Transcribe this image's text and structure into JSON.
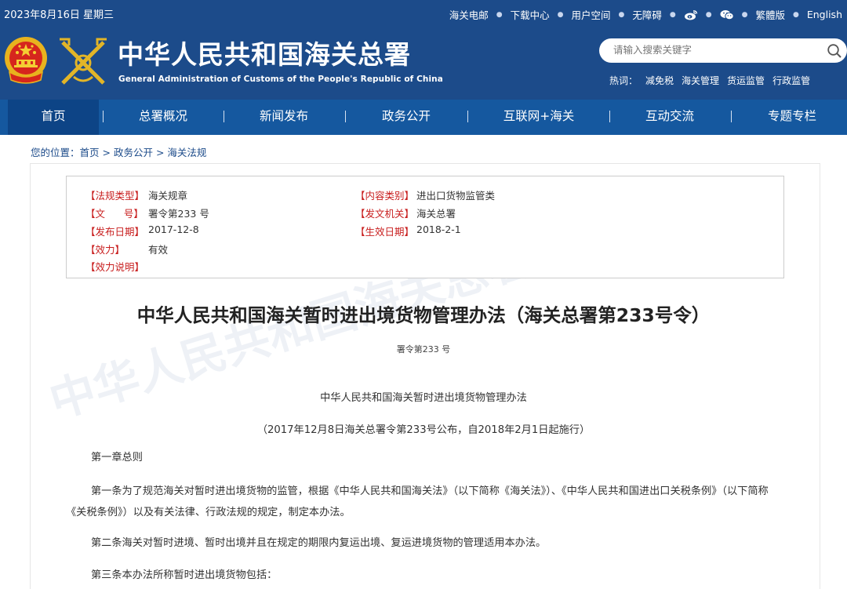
{
  "topbar": {
    "date": "2023年8月16日 星期三",
    "links": [
      "海关电邮",
      "下载中心",
      "用户空间",
      "无障碍",
      "weibo-icon",
      "wechat-icon",
      "繁體版",
      "English"
    ]
  },
  "header": {
    "title": "中华人民共和国海关总署",
    "subtitle": "General Administration of Customs of the People's Republic of China",
    "search_placeholder": "请输入搜索关键字",
    "hot_label": "热词：",
    "hot_words": [
      "减免税",
      "海关管理",
      "货运监管",
      "行政监管"
    ]
  },
  "nav": {
    "items": [
      "首页",
      "总署概况",
      "新闻发布",
      "政务公开",
      "互联网+海关",
      "互动交流",
      "专题专栏"
    ],
    "active_index": 0
  },
  "breadcrumb": {
    "prefix": "您的位置：",
    "items": [
      "首页",
      "政务公开",
      "海关法规"
    ],
    "separator": " > "
  },
  "info": {
    "law_type_label": "【法规类型】",
    "law_type": "海关规章",
    "content_type_label": "【内容类别】",
    "content_type": "进出口货物监管类",
    "doc_no_label": "【文      号】",
    "doc_no": "署令第233 号",
    "issuer_label": "【发文机关】",
    "issuer": "海关总署",
    "publish_date_label": "【发布日期】",
    "publish_date": "2017-12-8",
    "effective_date_label": "【生效日期】",
    "effective_date": "2018-2-1",
    "validity_label": "【效力】",
    "validity": "有效",
    "validity_note_label": "【效力说明】"
  },
  "article": {
    "title": "中华人民共和国海关暂时进出境货物管理办法（海关总署第233号令）",
    "number": "署令第233 号",
    "heading": "中华人民共和国海关暂时进出境货物管理办法",
    "issued": "（2017年12月8日海关总署令第233号公布，自2018年2月1日起施行）",
    "chapter": "第一章总则",
    "p1": "第一条为了规范海关对暂时进出境货物的监管，根据《中华人民共和国海关法》（以下简称《海关法》）、《中华人民共和国进出口关税条例》（以下简称《关税条例》）以及有关法律、行政法规的规定，制定本办法。",
    "p2": "第二条海关对暂时进境、暂时出境并且在规定的期限内复运出境、复运进境货物的管理适用本办法。",
    "p3": "第三条本办法所称暂时进出境货物包括："
  },
  "colors": {
    "header_bg": "#1c4b8a",
    "nav_bg": "#15589f",
    "nav_active_bg": "#0d4486",
    "label_red": "#c81e1e",
    "link_blue": "#1c4b8a"
  }
}
